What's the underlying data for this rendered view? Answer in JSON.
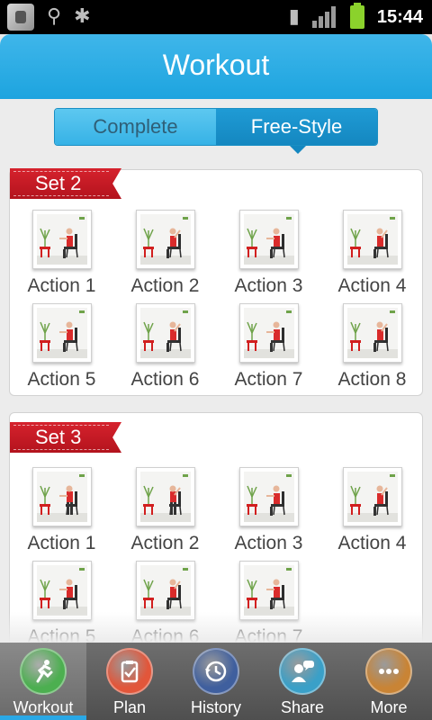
{
  "status_bar": {
    "time": "15:44",
    "icons": [
      "app-icon",
      "usb-icon",
      "android-debug-icon",
      "sd-card-icon",
      "signal-icon",
      "battery-icon"
    ]
  },
  "header": {
    "title": "Workout"
  },
  "segment": {
    "options": [
      "Complete",
      "Free-Style"
    ],
    "selected": "Free-Style"
  },
  "sets": [
    {
      "title": "Set 2",
      "actions": [
        "Action 1",
        "Action 2",
        "Action 3",
        "Action 4",
        "Action 5",
        "Action 6",
        "Action 7",
        "Action 8"
      ]
    },
    {
      "title": "Set 3",
      "actions": [
        "Action 1",
        "Action 2",
        "Action 3",
        "Action 4",
        "Action 5",
        "Action 6",
        "Action 7"
      ]
    }
  ],
  "tabs": [
    {
      "label": "Workout",
      "icon": "running-man-icon",
      "color": "#4caf50",
      "active": true
    },
    {
      "label": "Plan",
      "icon": "clipboard-check-icon",
      "color": "#e2563a",
      "active": false
    },
    {
      "label": "History",
      "icon": "history-clock-icon",
      "color": "#3f5f9e",
      "active": false
    },
    {
      "label": "Share",
      "icon": "share-chat-icon",
      "color": "#3aa0c8",
      "active": false
    },
    {
      "label": "More",
      "icon": "more-dots-icon",
      "color": "#c98435",
      "active": false
    }
  ],
  "colors": {
    "accent": "#1da4df",
    "ribbon": "#c81a24",
    "active_tab_bar": "#2aa8e6"
  }
}
